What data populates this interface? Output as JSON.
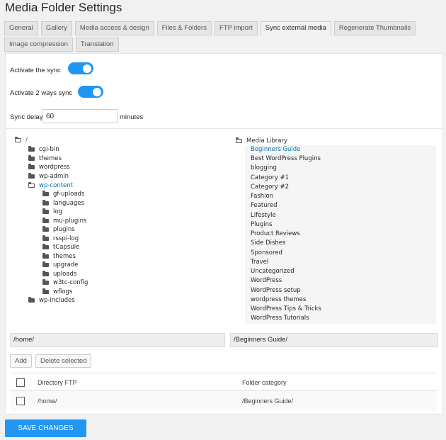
{
  "page": {
    "title": "Media Folder Settings"
  },
  "tabs": [
    {
      "label": "General",
      "active": false
    },
    {
      "label": "Gallery",
      "active": false
    },
    {
      "label": "Media access & design",
      "active": false
    },
    {
      "label": "Files & Folders",
      "active": false
    },
    {
      "label": "FTP import",
      "active": false
    },
    {
      "label": "Sync external media",
      "active": true
    },
    {
      "label": "Regenerate Thumbnails",
      "active": false
    },
    {
      "label": "Image compression",
      "active": false
    },
    {
      "label": "Translation",
      "active": false
    }
  ],
  "sync": {
    "activate_label": "Activate the sync",
    "activate_on": true,
    "two_way_label": "Activate 2 ways sync",
    "two_way_on": true,
    "delay_label": "Sync delay",
    "delay_value": "60",
    "delay_unit": "minutes"
  },
  "ftp_tree": {
    "root": "/",
    "items": [
      {
        "label": "cgi-bin",
        "level": 1
      },
      {
        "label": "themes",
        "level": 1
      },
      {
        "label": "wordpress",
        "level": 1
      },
      {
        "label": "wp-admin",
        "level": 1
      },
      {
        "label": "wp-content",
        "level": 1,
        "open": true
      },
      {
        "label": "gf-uploads",
        "level": 2
      },
      {
        "label": "languages",
        "level": 2
      },
      {
        "label": "log",
        "level": 2
      },
      {
        "label": "mu-plugins",
        "level": 2
      },
      {
        "label": "plugins",
        "level": 2
      },
      {
        "label": "rsspi-log",
        "level": 2
      },
      {
        "label": "tCapsule",
        "level": 2
      },
      {
        "label": "themes",
        "level": 2
      },
      {
        "label": "upgrade",
        "level": 2
      },
      {
        "label": "uploads",
        "level": 2
      },
      {
        "label": "w3tc-config",
        "level": 2
      },
      {
        "label": "wflogs",
        "level": 2
      },
      {
        "label": "wp-includes",
        "level": 1
      }
    ]
  },
  "media_library": {
    "title": "Media Library",
    "items": [
      "Beginners Guide",
      "Best WordPress Plugins",
      "blogging",
      "Category #1",
      "Category #2",
      "Fashion",
      "Featured",
      "Lifestyle",
      "Plugins",
      "Product Reviews",
      "Side Dishes",
      "Sponsored",
      "Travel",
      "Uncategorized",
      "WordPress",
      "WordPress setup",
      "wordpress themes",
      "WordPress Tips & Tricks",
      "WordPress Tutorials"
    ],
    "selected": "Beginners Guide"
  },
  "paths": {
    "ftp": "/home/",
    "library": "/Beginners Guide/"
  },
  "buttons": {
    "add": "Add",
    "delete": "Delete selected",
    "save": "SAVE CHANGES"
  },
  "table": {
    "headers": [
      "Directory FTP",
      "Folder category"
    ],
    "rows": [
      {
        "ftp": "/home/",
        "category": "/Beginners Guide/"
      }
    ]
  },
  "colors": {
    "accent": "#2196f3",
    "link": "#0073aa"
  }
}
